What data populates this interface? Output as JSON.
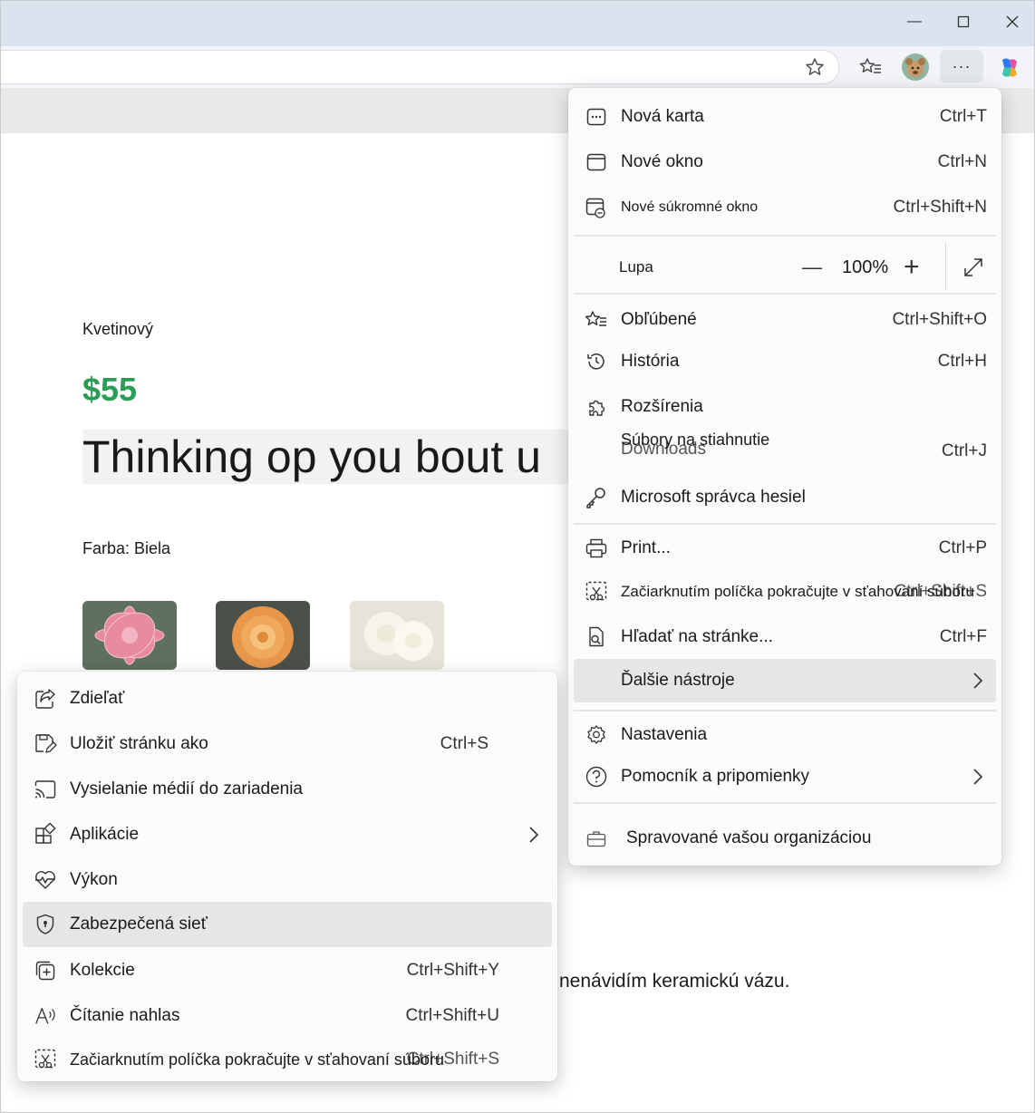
{
  "browser": {
    "window_buttons": {
      "minimize": "—",
      "maximize": "☐",
      "close": "✕"
    },
    "toolbar": {
      "more_label": "···"
    }
  },
  "page": {
    "category": "Kvetinový",
    "price": "$55",
    "headline": "Thinking op you bout u",
    "color_label": "Farba: Biela",
    "thumbnails": [
      {
        "color": "#e88aa0",
        "accent": "#f6c6d2"
      },
      {
        "color": "#e8964a",
        "accent": "#f5c07a"
      },
      {
        "color": "#f3f1e6",
        "accent": "#ffffff"
      }
    ],
    "bottom_text": "nenávidím keramickú vázu."
  },
  "main_menu": {
    "items": [
      {
        "label": "Nová karta",
        "shortcut": "Ctrl+T"
      },
      {
        "label": "Nové okno",
        "shortcut": "Ctrl+N"
      },
      {
        "label": "Nové súkromné okno",
        "shortcut": "Ctrl+Shift+N"
      },
      {
        "label": "Obľúbené",
        "shortcut": "Ctrl+Shift+O"
      },
      {
        "label": "História",
        "shortcut": "Ctrl+H"
      },
      {
        "label": "Rozšírenia",
        "shortcut": ""
      },
      {
        "label": "Súbory na stiahnutie",
        "label_under": "Downloads",
        "shortcut": "Ctrl+J"
      },
      {
        "label": "Microsoft správca hesiel",
        "shortcut": ""
      },
      {
        "label": "Print...",
        "shortcut": "Ctrl+P"
      },
      {
        "label": "Začiarknutím políčka pokračujte v sťahovaní súboru",
        "shortcut": "Ctrl+Shift+S"
      },
      {
        "label": "Hľadať na stránke...",
        "shortcut": "Ctrl+F"
      },
      {
        "label": "Ďalšie nástroje",
        "shortcut": ""
      },
      {
        "label": "Nastavenia",
        "shortcut": ""
      },
      {
        "label": "Pomocník a pripomienky",
        "shortcut": ""
      },
      {
        "label": "Spravované vašou organizáciou",
        "shortcut": ""
      }
    ],
    "zoom": {
      "label": "Lupa",
      "value": "100%",
      "minus": "—",
      "plus": "+"
    }
  },
  "sub_menu": {
    "items": [
      {
        "label": "Zdieľať",
        "shortcut": ""
      },
      {
        "label": "Uložiť stránku ako",
        "shortcut": "Ctrl+S"
      },
      {
        "label": "Vysielanie médií do zariadenia",
        "shortcut": ""
      },
      {
        "label": "Aplikácie",
        "shortcut": ""
      },
      {
        "label": "Výkon",
        "shortcut": ""
      },
      {
        "label": "Zabezpečená sieť",
        "shortcut": ""
      },
      {
        "label": "Kolekcie",
        "shortcut": "Ctrl+Shift+Y"
      },
      {
        "label": "Čítanie nahlas",
        "shortcut": "Ctrl+Shift+U"
      },
      {
        "label": "Začiarknutím políčka pokračujte v sťahovaní súboru",
        "shortcut": "Ctrl+Shift+S"
      }
    ]
  },
  "colors": {
    "price": "#2a9d55",
    "highlight": "#e6e6e6",
    "titlebar": "#dbe4ee"
  }
}
